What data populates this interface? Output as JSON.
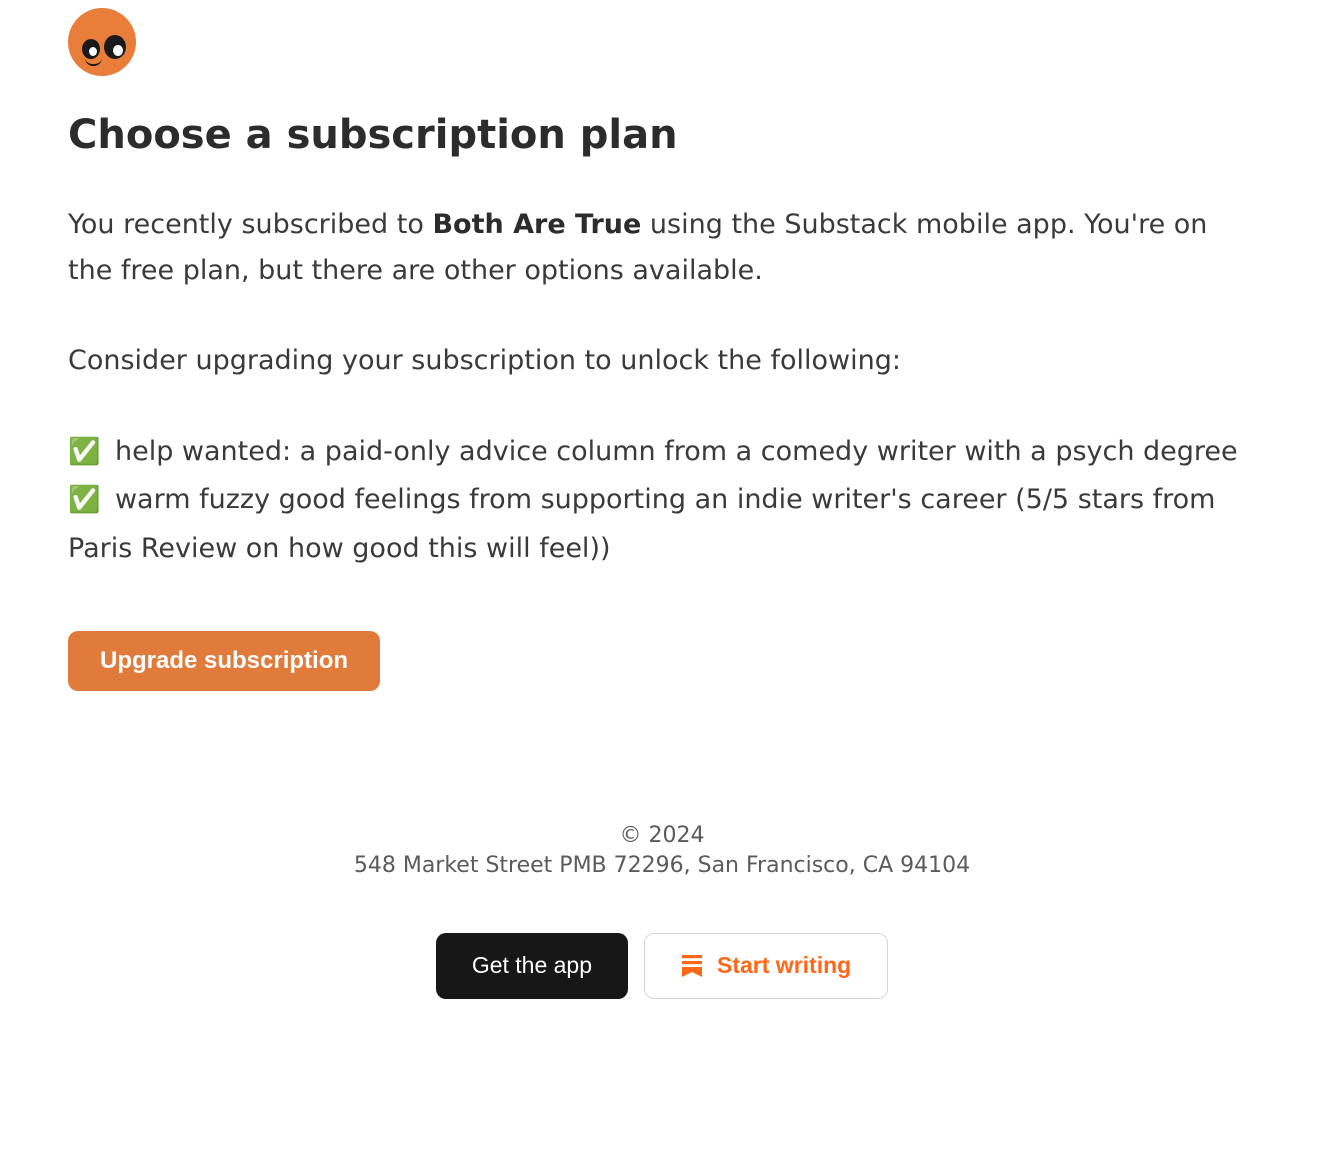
{
  "header": {
    "logo_name": "publication-logo"
  },
  "title": "Choose a subscription plan",
  "intro": {
    "pre": "You recently subscribed to ",
    "publication": "Both Are True",
    "post": " using the Substack mobile app. You're on the free plan, but there are other options available."
  },
  "consider_text": "Consider upgrading your subscription to unlock the following:",
  "benefits": [
    "help wanted: a paid-only advice column from a comedy writer with a psych degree",
    "warm fuzzy good feelings from supporting an indie writer's career (5/5 stars from Paris Review on how good this will feel))"
  ],
  "check_glyph": "✅",
  "upgrade_button": "Upgrade subscription",
  "footer": {
    "copyright": "© 2024",
    "address": "548 Market Street PMB 72296, San Francisco, CA 94104",
    "get_app_label": "Get the app",
    "start_writing_label": "Start writing"
  }
}
